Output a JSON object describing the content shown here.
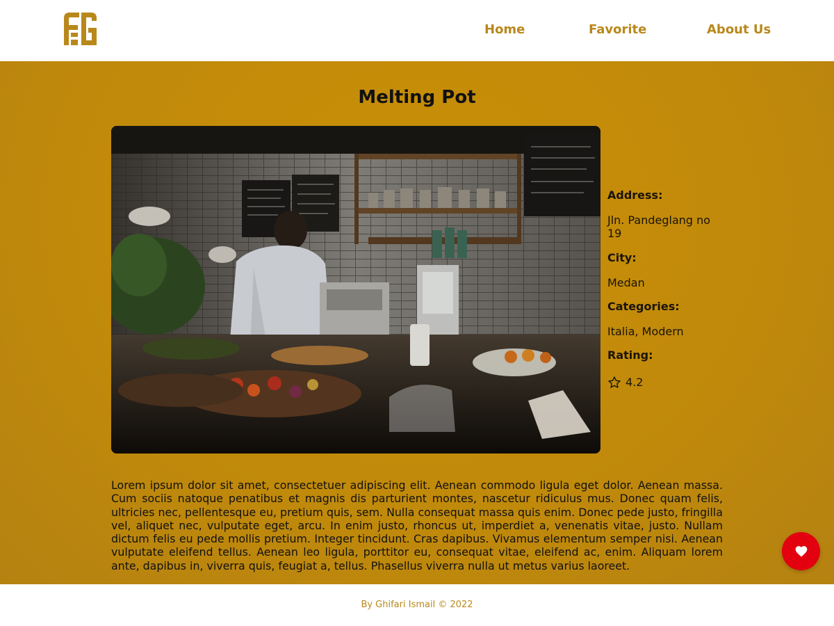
{
  "colors": {
    "brand": "#b9881b",
    "main_background": "#c18a0a",
    "favorite_button": "#e3000f"
  },
  "header": {
    "logo_icon": "brand-logo-icon",
    "nav": [
      {
        "label": "Home"
      },
      {
        "label": "Favorite"
      },
      {
        "label": "About Us"
      }
    ]
  },
  "restaurant": {
    "name": "Melting Pot",
    "address_label": "Address:",
    "address": "Jln. Pandeglang no 19",
    "city_label": "City:",
    "city": "Medan",
    "categories_label": "Categories:",
    "categories": "Italia, Modern",
    "rating_label": "Rating:",
    "rating_icon": "star-icon",
    "rating": "4.2",
    "description": "Lorem ipsum dolor sit amet, consectetuer adipiscing elit. Aenean commodo ligula eget dolor. Aenean massa. Cum sociis natoque penatibus et magnis dis parturient montes, nascetur ridiculus mus. Donec quam felis, ultricies nec, pellentesque eu, pretium quis, sem. Nulla consequat massa quis enim. Donec pede justo, fringilla vel, aliquet nec, vulputate eget, arcu. In enim justo, rhoncus ut, imperdiet a, venenatis vitae, justo. Nullam dictum felis eu pede mollis pretium. Integer tincidunt. Cras dapibus. Vivamus elementum semper nisi. Aenean vulputate eleifend tellus. Aenean leo ligula, porttitor eu, consequat vitae, eleifend ac, enim. Aliquam lorem ante, dapibus in, viverra quis, feugiat a, tellus. Phasellus viverra nulla ut metus varius laoreet."
  },
  "favorite_button_icon": "heart-icon",
  "footer": {
    "text": "By Ghifari Ismail © 2022"
  }
}
